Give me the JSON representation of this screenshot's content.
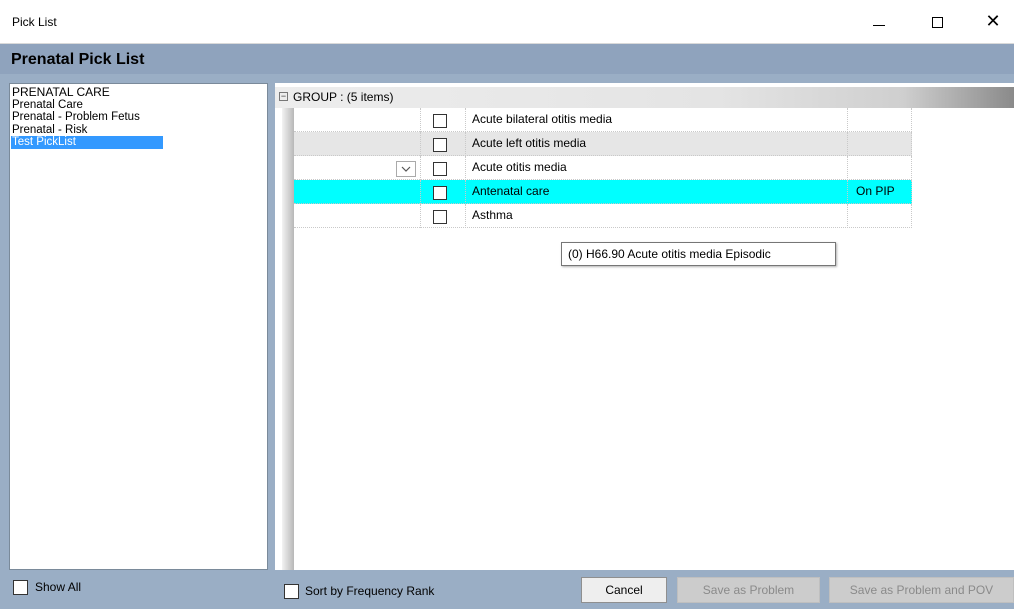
{
  "window": {
    "title": "Pick List"
  },
  "header": {
    "title": "Prenatal Pick List"
  },
  "sidebar": {
    "items": [
      {
        "label": "PRENATAL CARE",
        "selected": false
      },
      {
        "label": "Prenatal Care",
        "selected": false
      },
      {
        "label": "Prenatal - Problem Fetus",
        "selected": false
      },
      {
        "label": "Prenatal - Risk",
        "selected": false
      },
      {
        "label": "Test PickList",
        "selected": true
      }
    ]
  },
  "grid": {
    "group_label": "GROUP :  (5 items)",
    "rows": [
      {
        "name": "Acute bilateral otitis media",
        "status": ""
      },
      {
        "name": "Acute left otitis media",
        "status": ""
      },
      {
        "name": "Acute otitis media",
        "status": ""
      },
      {
        "name": "Antenatal care",
        "status": "On PIP"
      },
      {
        "name": "Asthma",
        "status": ""
      }
    ],
    "tooltip": "(0) H66.90  Acute otitis media  Episodic"
  },
  "footer": {
    "show_all_label": "Show All",
    "sort_label": "Sort by Frequency Rank",
    "cancel_label": "Cancel",
    "save_problem_label": "Save as Problem",
    "save_problem_pov_label": "Save as Problem and POV"
  },
  "colors": {
    "header_bg": "#8fa3bd",
    "selection": "#3399ff",
    "highlight_row": "#00ffff"
  }
}
